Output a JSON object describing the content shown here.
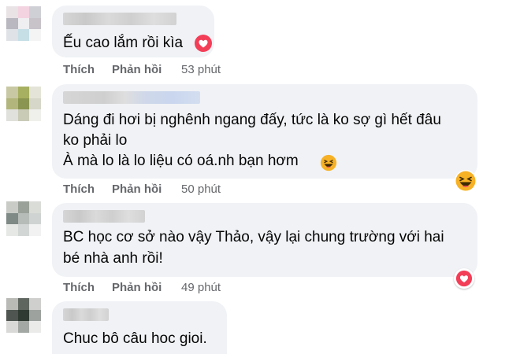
{
  "comments": [
    {
      "text_lines": [
        "Ếu cao lắm rồi kìa"
      ],
      "like_label": "Thích",
      "reply_label": "Phản hồi",
      "time": "53 phút",
      "reaction": "heart-icon"
    },
    {
      "text_lines": [
        "Dáng đi hơi bị nghênh ngang đấy, tức là ko sợ gì hết đâu",
        "ko phải lo",
        "À mà lo là lo liệu có oá.nh bạn hơm"
      ],
      "like_label": "Thích",
      "reply_label": "Phản hồi",
      "time": "50 phút",
      "reaction": "haha-icon"
    },
    {
      "text_lines": [
        "BC học cơ sở nào vậy Thảo, vậy lại chung trường với hai",
        "bé nhà anh rồi!"
      ],
      "like_label": "Thích",
      "reply_label": "Phản hồi",
      "time": "49 phút",
      "reaction": "heart-icon"
    },
    {
      "text_lines": [
        "Chuc bô câu hoc gioi."
      ]
    }
  ],
  "colors": {
    "bubble": "#f0f2f5",
    "meta": "#65676b",
    "heart": "#f33e58",
    "haha": "#f7b125"
  }
}
